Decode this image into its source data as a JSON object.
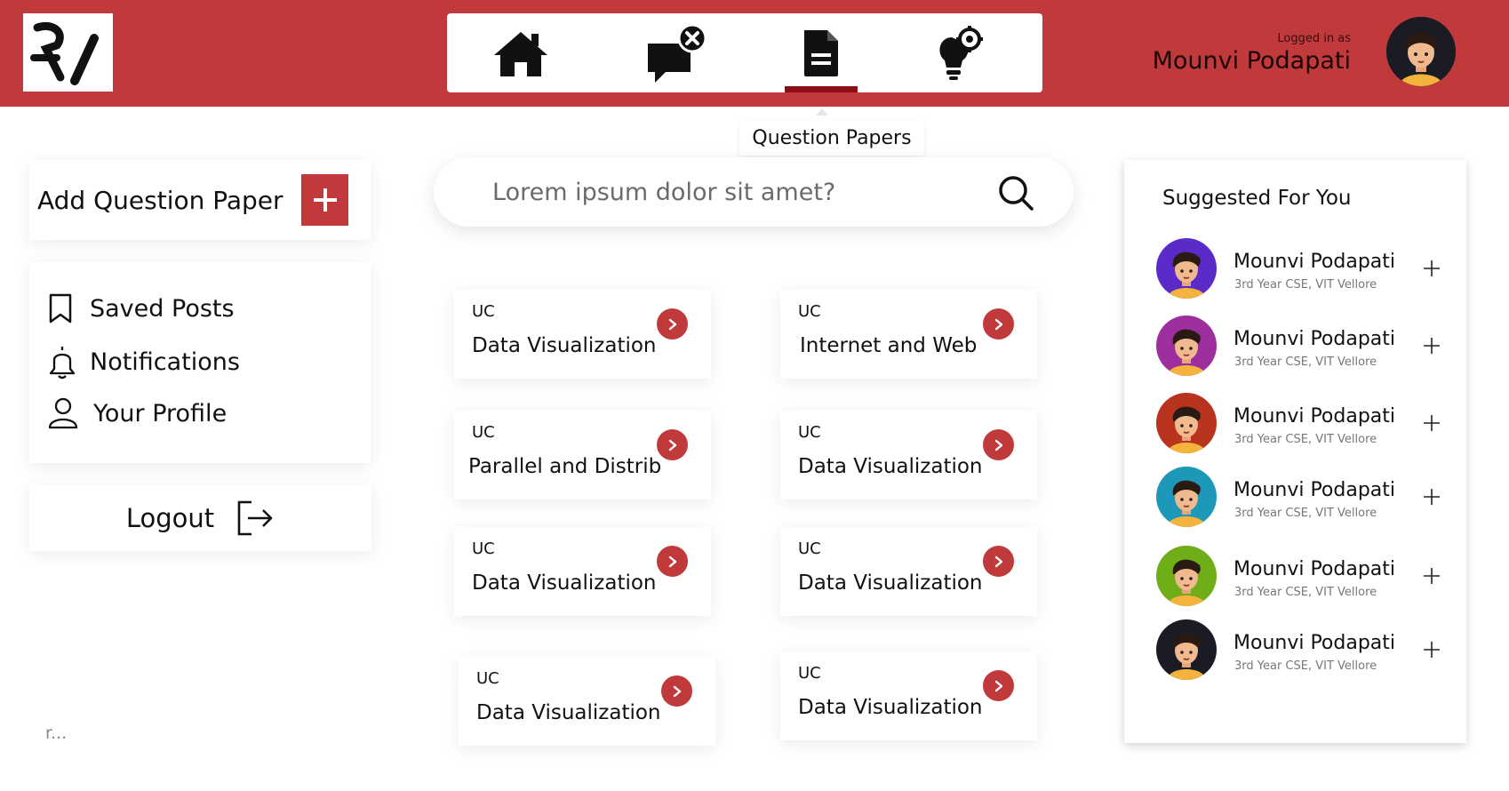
{
  "colors": {
    "brand": "#C0393B",
    "underline": "#8B0F14",
    "avatar_dark": "#1b1b24"
  },
  "nav": {
    "items": [
      {
        "icon": "home-icon"
      },
      {
        "icon": "chat-close-icon"
      },
      {
        "icon": "document-icon",
        "active": true
      },
      {
        "icon": "bulb-gear-icon"
      }
    ],
    "tooltip": "Question Papers"
  },
  "user": {
    "caption": "Logged in as",
    "name": "Mounvi Podapati"
  },
  "sidebar": {
    "add_label": "Add Question Paper",
    "menu": [
      {
        "label": "Saved Posts",
        "icon": "bookmark-icon"
      },
      {
        "label": "Notifications",
        "icon": "bell-icon"
      },
      {
        "label": "Your Profile",
        "icon": "user-icon"
      }
    ],
    "logout_label": "Logout",
    "footnote": "r..."
  },
  "search": {
    "placeholder": "Lorem ipsum dolor sit amet?"
  },
  "papers": [
    {
      "code": "UC",
      "title": "Data Visualization"
    },
    {
      "code": "UC",
      "title": "Internet and Web"
    },
    {
      "code": "UC",
      "title": "Parallel and Distrib"
    },
    {
      "code": "UC",
      "title": "Data Visualization"
    },
    {
      "code": "UC",
      "title": "Data Visualization"
    },
    {
      "code": "UC",
      "title": "Data Visualization"
    },
    {
      "code": "UC",
      "title": "Data Visualization"
    },
    {
      "code": "UC",
      "title": "Data Visualization"
    }
  ],
  "suggested": {
    "title": "Suggested For You",
    "items": [
      {
        "name": "Mounvi Podapati",
        "sub": "3rd Year CSE, VIT Vellore",
        "color": "#5B2BC9"
      },
      {
        "name": "Mounvi Podapati",
        "sub": "3rd Year CSE, VIT Vellore",
        "color": "#9C2E9E"
      },
      {
        "name": "Mounvi Podapati",
        "sub": "3rd Year CSE, VIT Vellore",
        "color": "#B8341E"
      },
      {
        "name": "Mounvi Podapati",
        "sub": "3rd Year CSE, VIT Vellore",
        "color": "#1E98B8"
      },
      {
        "name": "Mounvi Podapati",
        "sub": "3rd Year CSE, VIT Vellore",
        "color": "#6FAE19"
      },
      {
        "name": "Mounvi Podapati",
        "sub": "3rd Year CSE, VIT Vellore",
        "color": "#1b1b24"
      }
    ]
  }
}
